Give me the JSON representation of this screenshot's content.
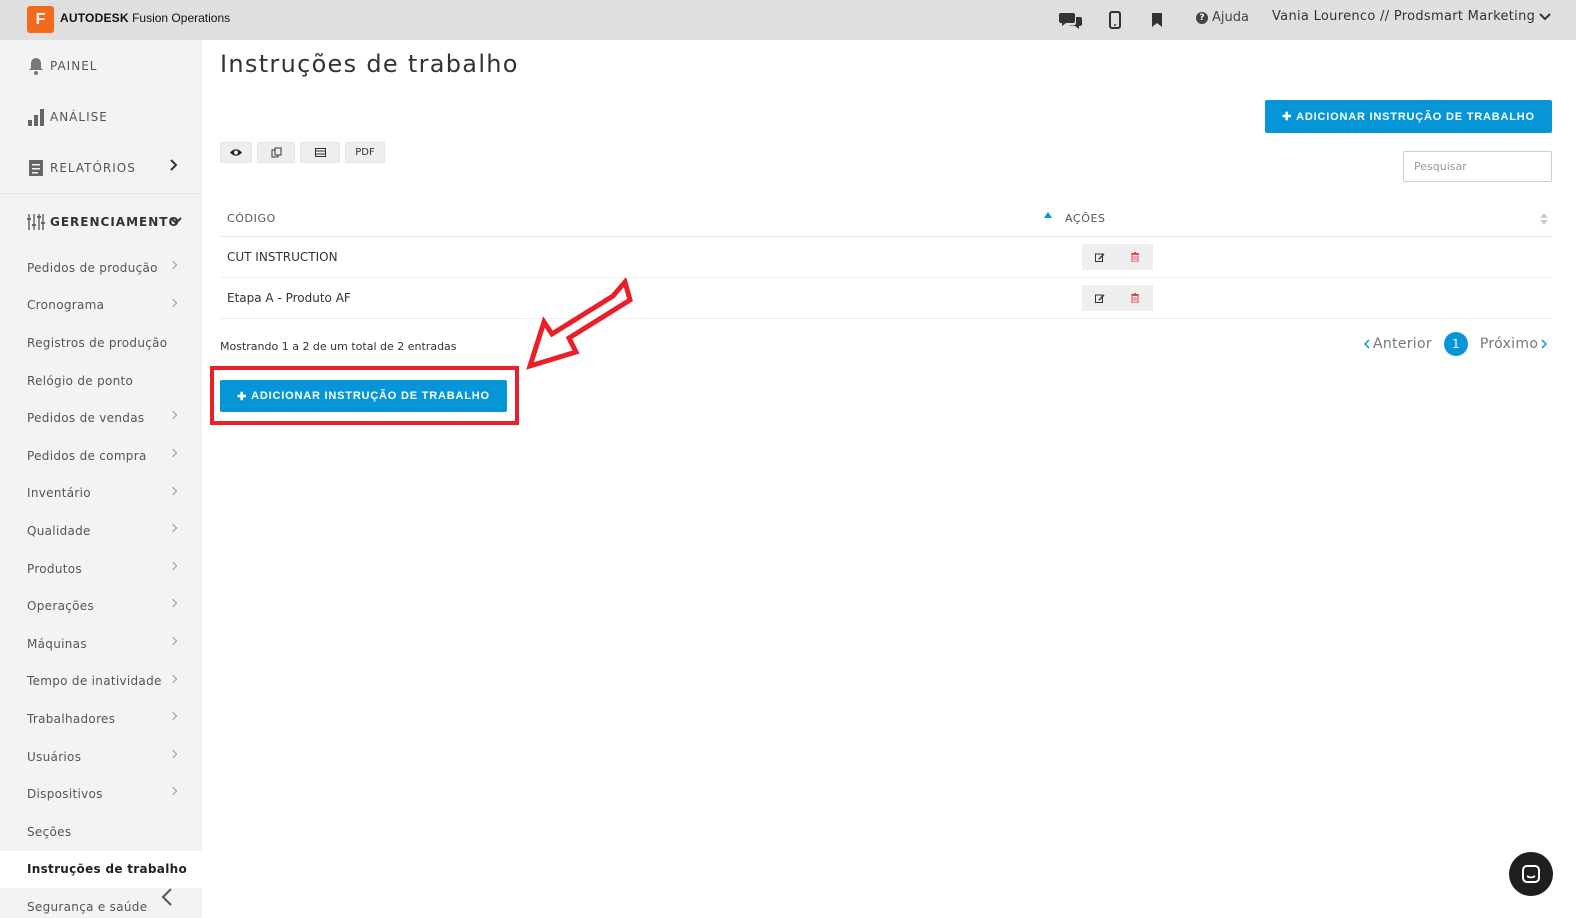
{
  "topbar": {
    "logo_letter": "F",
    "brand_bold": "AUTODESK",
    "brand_rest": "Fusion Operations",
    "help_label": "Ajuda",
    "user_label": "Vania Lourenco // Prodsmart Marketing",
    "icons": [
      "chat-icon",
      "mobile-icon",
      "bookmark-icon",
      "help-icon"
    ]
  },
  "sidebar": {
    "top_items": [
      {
        "label": "PAINEL",
        "icon": "bell-icon"
      },
      {
        "label": "ANÁLISE",
        "icon": "bar-chart-icon"
      },
      {
        "label": "RELATÓRIOS",
        "icon": "report-icon"
      }
    ],
    "group_label": "GERENCIAMENTO",
    "items": [
      {
        "label": "Pedidos de produção",
        "arrow": true
      },
      {
        "label": "Cronograma",
        "arrow": true
      },
      {
        "label": "Registros de produção",
        "arrow": false
      },
      {
        "label": "Relógio de ponto",
        "arrow": false
      },
      {
        "label": "Pedidos de vendas",
        "arrow": true
      },
      {
        "label": "Pedidos de compra",
        "arrow": true
      },
      {
        "label": "Inventário",
        "arrow": true
      },
      {
        "label": "Qualidade",
        "arrow": true
      },
      {
        "label": "Produtos",
        "arrow": true
      },
      {
        "label": "Operações",
        "arrow": true
      },
      {
        "label": "Máquinas",
        "arrow": true
      },
      {
        "label": "Tempo de inatividade",
        "arrow": true
      },
      {
        "label": "Trabalhadores",
        "arrow": true
      },
      {
        "label": "Usuários",
        "arrow": true
      },
      {
        "label": "Dispositivos",
        "arrow": true
      },
      {
        "label": "Seções",
        "arrow": false
      },
      {
        "label": "Instruções de trabalho",
        "arrow": false,
        "active": true
      },
      {
        "label": "Segurança e saúde",
        "arrow": false
      }
    ]
  },
  "main": {
    "title": "Instruções de trabalho",
    "add_button_label": "ADICIONAR INSTRUÇÃO DE TRABALHO",
    "tool_pdf_label": "PDF",
    "search_placeholder": "Pesquisar",
    "table": {
      "headers": [
        "CÓDIGO",
        "AÇÕES"
      ],
      "rows": [
        "CUT INSTRUCTION",
        "Etapa A - Produto AF"
      ]
    },
    "info_text": "Mostrando 1 a 2 de um total de 2 entradas",
    "pager": {
      "prev": "Anterior",
      "page": "1",
      "next": "Próximo"
    }
  },
  "colors": {
    "accent": "#0696d7",
    "highlight": "#e8202a",
    "brand": "#f26b1d"
  }
}
